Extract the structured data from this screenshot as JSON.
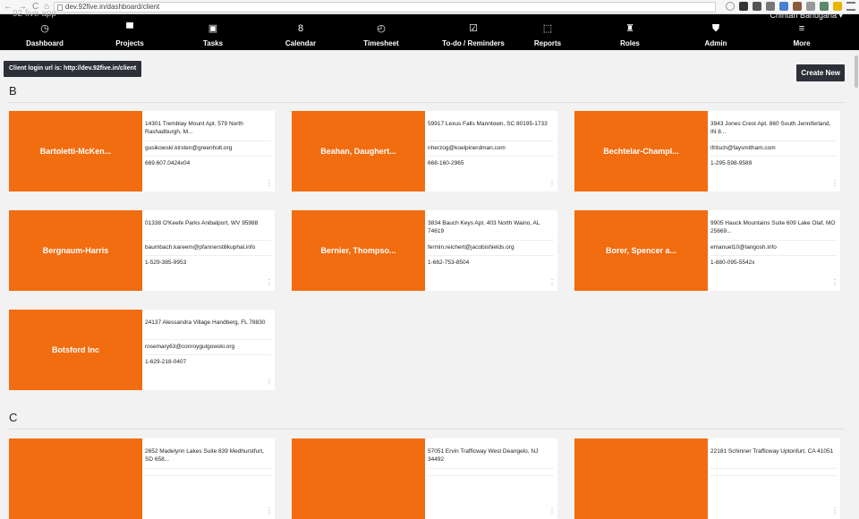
{
  "browser": {
    "back": "←",
    "forward": "→",
    "reload": "C",
    "home": "⌂",
    "url": "dev.92five.in/dashboard/client"
  },
  "app": {
    "name": "92 five app",
    "user": "Chintan Banugaria ▾"
  },
  "nav": [
    {
      "label": "Dashboard",
      "icon": "speedometer-icon",
      "glyph": "◷"
    },
    {
      "label": "Projects",
      "icon": "presentation-icon",
      "glyph": "▀"
    },
    {
      "label": "Tasks",
      "icon": "clipboard-icon",
      "glyph": "▣"
    },
    {
      "label": "Calendar",
      "icon": "calendar-icon",
      "glyph": "8"
    },
    {
      "label": "Timesheet",
      "icon": "clock-icon",
      "glyph": "◴"
    },
    {
      "label": "To-do / Reminders",
      "icon": "checklist-icon",
      "glyph": "☑"
    },
    {
      "label": "Reports",
      "icon": "chart-icon",
      "glyph": "⬚"
    },
    {
      "label": "Roles",
      "icon": "roles-icon",
      "glyph": "♜"
    },
    {
      "label": "Admin",
      "icon": "shield-icon",
      "glyph": "⛊"
    },
    {
      "label": "More",
      "icon": "menu-icon",
      "glyph": "≡"
    }
  ],
  "login_url_text": "Client login url is: http://dev.92five.in/client",
  "create_new": "Create New",
  "groups": [
    {
      "letter": "B",
      "clients": [
        {
          "name": "Bartoletti-McKen...",
          "address": "14301 Tremblay Mount Apt. 579 North Rashadburgh, M...",
          "email": "gusikowski.kirsten@greenholt.org",
          "phone": "669.607.0424x04"
        },
        {
          "name": "Beahan, Daughert...",
          "address": "59917 Lexus Falls Manntown, SC 80195-1733",
          "email": "nherzog@koelpinerdman.com",
          "phone": "668-160-2965"
        },
        {
          "name": "Bechtelar-Champl...",
          "address": "3943 Jones Crest Apt. 860 South Jenniferland, IN 8...",
          "email": "ifritsch@faysmitham.com",
          "phone": "1-295-598-9589"
        },
        {
          "name": "Bergnaum-Harris",
          "address": "01338 O'Keefe Parks Anibalport, WV 95988",
          "email": "baumbach.kareem@pfannerstillkuphal.info",
          "phone": "1-529-385-9953"
        },
        {
          "name": "Bernier, Thompso...",
          "address": "3834 Bauch Keys Apt. 403 North Waino, AL 74619",
          "email": "fermin.reichert@jacobishields.org",
          "phone": "1-662-753-8504"
        },
        {
          "name": "Borer, Spencer a...",
          "address": "9905 Hauck Mountains Suite 609 Lake Olaf, MO 25669...",
          "email": "emanuel10@langosh.info",
          "phone": "1-880-095-5542x"
        },
        {
          "name": "Botsford Inc",
          "address": "24137 Alessandra Village Handberg, FL 78830",
          "email": "rosemary63@conroygulgowski.org",
          "phone": "1-629-218-0407"
        }
      ]
    },
    {
      "letter": "C",
      "clients": [
        {
          "name": "",
          "address": "2652 Madelynn Lakes Suite 839 Medhurstfurt, SD 658...",
          "email": "",
          "phone": ""
        },
        {
          "name": "",
          "address": "57051 Ervin Trafficway West Deangelo, NJ 34492",
          "email": "",
          "phone": ""
        },
        {
          "name": "",
          "address": "22181 Schinner Trafficway Uptonfurt, CA 41051",
          "email": "",
          "phone": ""
        }
      ]
    }
  ],
  "card_menu_glyph": "⋮"
}
